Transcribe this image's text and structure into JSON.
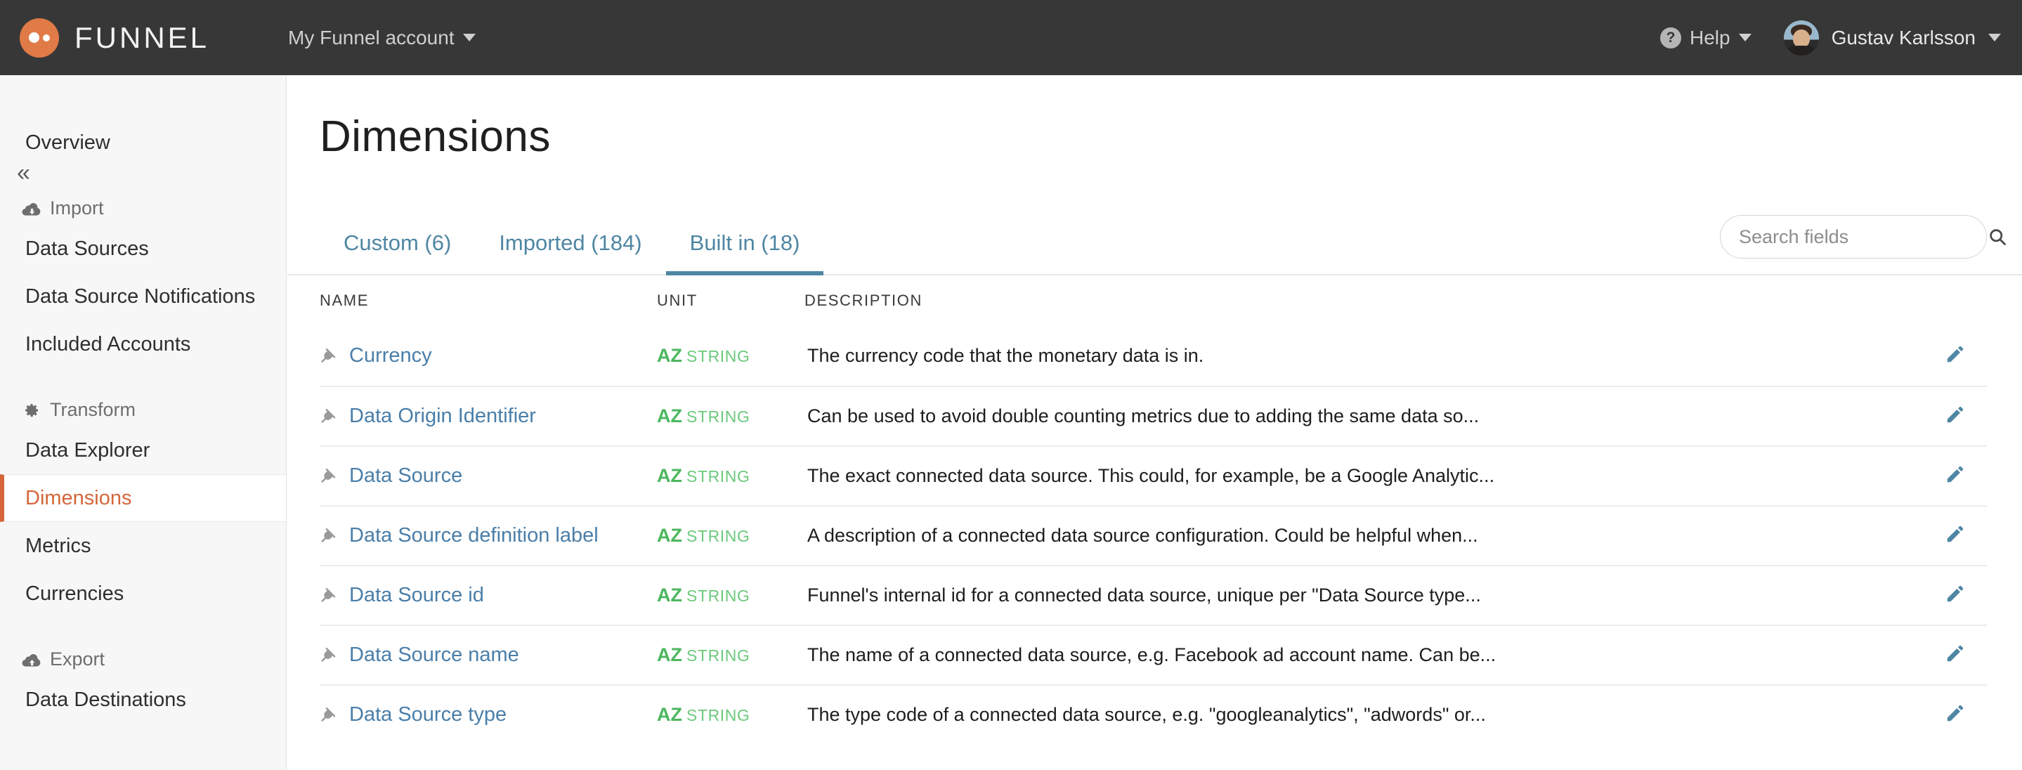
{
  "topnav": {
    "brand": "FUNNEL",
    "account_menu": "My Funnel account",
    "help_label": "Help",
    "help_glyph": "?",
    "user_name": "Gustav Karlsson"
  },
  "sidebar": {
    "collapse_glyph": "«",
    "items": [
      {
        "label": "Overview",
        "type": "item",
        "active": false
      },
      {
        "label": "Import",
        "type": "section",
        "icon": "cloud-download-icon"
      },
      {
        "label": "Data Sources",
        "type": "item",
        "active": false
      },
      {
        "label": "Data Source Notifications",
        "type": "item",
        "active": false
      },
      {
        "label": "Included Accounts",
        "type": "item",
        "active": false
      },
      {
        "label": "Transform",
        "type": "section",
        "icon": "gear-icon"
      },
      {
        "label": "Data Explorer",
        "type": "item",
        "active": false
      },
      {
        "label": "Dimensions",
        "type": "item",
        "active": true
      },
      {
        "label": "Metrics",
        "type": "item",
        "active": false
      },
      {
        "label": "Currencies",
        "type": "item",
        "active": false
      },
      {
        "label": "Export",
        "type": "section",
        "icon": "cloud-upload-icon"
      },
      {
        "label": "Data Destinations",
        "type": "item",
        "active": false
      }
    ]
  },
  "main": {
    "title": "Dimensions",
    "tabs": [
      {
        "label": "Custom (6)",
        "active": false
      },
      {
        "label": "Imported (184)",
        "active": false
      },
      {
        "label": "Built in (18)",
        "active": true
      }
    ],
    "search": {
      "value": "",
      "placeholder": "Search fields",
      "icon": "search-icon"
    },
    "table": {
      "columns": [
        "NAME",
        "UNIT",
        "DESCRIPTION"
      ],
      "rows": [
        {
          "name": "Currency",
          "name_icon": "plug-icon",
          "unit_code": "AZ",
          "unit_type": "STRING",
          "description": "The currency code that the monetary data is in.",
          "action_icon": "pencil-icon"
        },
        {
          "name": "Data Origin Identifier",
          "name_icon": "plug-icon",
          "unit_code": "AZ",
          "unit_type": "STRING",
          "description": "Can be used to avoid double counting metrics due to adding the same data so...",
          "action_icon": "pencil-icon"
        },
        {
          "name": "Data Source",
          "name_icon": "plug-icon",
          "unit_code": "AZ",
          "unit_type": "STRING",
          "description": "The exact connected data source. This could, for example, be a Google Analytic...",
          "action_icon": "pencil-icon"
        },
        {
          "name": "Data Source definition label",
          "name_icon": "plug-icon",
          "unit_code": "AZ",
          "unit_type": "STRING",
          "description": "A description of a connected data source configuration. Could be helpful when...",
          "action_icon": "pencil-icon"
        },
        {
          "name": "Data Source id",
          "name_icon": "plug-icon",
          "unit_code": "AZ",
          "unit_type": "STRING",
          "description": "Funnel's internal id for a connected data source, unique per \"Data Source type...",
          "action_icon": "pencil-icon"
        },
        {
          "name": "Data Source name",
          "name_icon": "plug-icon",
          "unit_code": "AZ",
          "unit_type": "STRING",
          "description": "The name of a connected data source, e.g. Facebook ad account name. Can be...",
          "action_icon": "pencil-icon"
        },
        {
          "name": "Data Source type",
          "name_icon": "plug-icon",
          "unit_code": "AZ",
          "unit_type": "STRING",
          "description": "The type code of a connected data source, e.g. \"googleanalytics\", \"adwords\" or...",
          "action_icon": "pencil-icon"
        }
      ]
    }
  },
  "colors": {
    "topnav_bg": "#373737",
    "brand_accent": "#e07a47",
    "sidebar_bg": "#f7f7f7",
    "active_nav": "#d4663a",
    "tab_blue": "#4f86a3",
    "link_blue": "#4a7ea8",
    "unit_green": "#4cb75e"
  }
}
